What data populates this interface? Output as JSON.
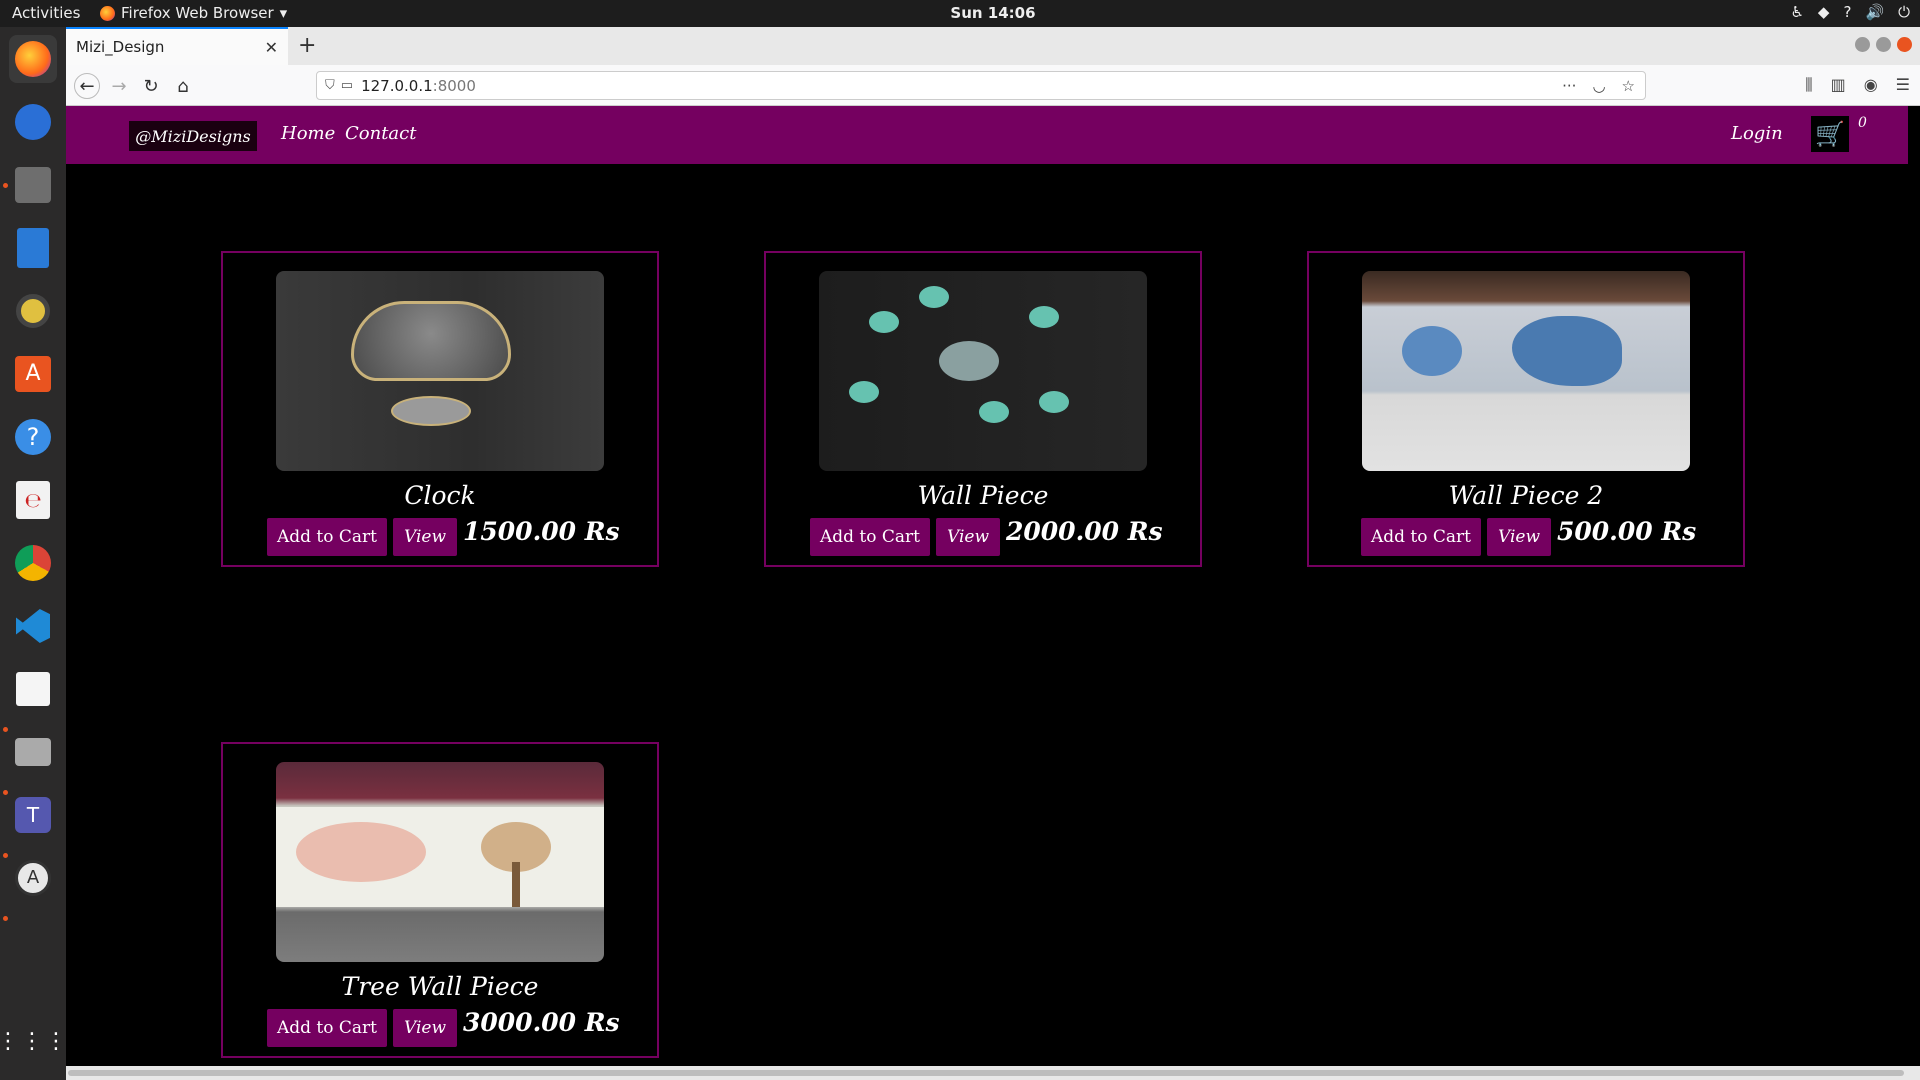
{
  "system": {
    "activities": "Activities",
    "app_name": "Firefox Web Browser",
    "clock": "Sun 14:06"
  },
  "browser": {
    "tab_title": "Mizi_Design",
    "url_host": "127.0.0.1",
    "url_port": ":8000"
  },
  "site": {
    "brand": "@MiziDesigns",
    "nav": {
      "home": "Home",
      "contact": "Contact"
    },
    "login": "Login",
    "cart_count": "0",
    "accent_color": "#750060"
  },
  "products": [
    {
      "title": "Clock",
      "add_label": "Add to Cart",
      "view_label": "View",
      "price": "1500.00 Rs"
    },
    {
      "title": "Wall Piece",
      "add_label": "Add to Cart",
      "view_label": "View",
      "price": "2000.00 Rs"
    },
    {
      "title": "Wall Piece 2",
      "add_label": "Add to Cart",
      "view_label": "View",
      "price": "500.00 Rs"
    },
    {
      "title": "Tree Wall Piece",
      "add_label": "Add to Cart",
      "view_label": "View",
      "price": "3000.00 Rs"
    }
  ]
}
